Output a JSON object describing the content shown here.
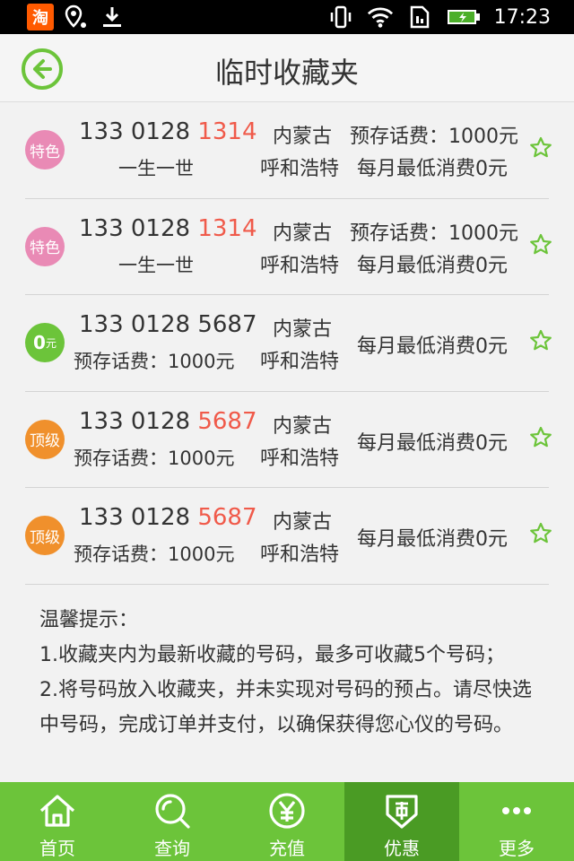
{
  "status_bar": {
    "time": "17:23",
    "taobao_label": "淘"
  },
  "header": {
    "title": "临时收藏夹"
  },
  "items": [
    {
      "badge": "特色",
      "badge_type": "special",
      "number_prefix": "133 0128 ",
      "number_suffix": "1314",
      "suffix_highlight": true,
      "sub": "一生一世",
      "region_line1": "内蒙古",
      "region_line2": "呼和浩特",
      "prestore": "预存话费：1000元",
      "min_spend": "每月最低消费0元"
    },
    {
      "badge": "特色",
      "badge_type": "special",
      "number_prefix": "133 0128 ",
      "number_suffix": "1314",
      "suffix_highlight": true,
      "sub": "一生一世",
      "region_line1": "内蒙古",
      "region_line2": "呼和浩特",
      "prestore": "预存话费：1000元",
      "min_spend": "每月最低消费0元"
    },
    {
      "badge": "0",
      "badge_unit": "元",
      "badge_type": "zero",
      "number_prefix": "133 0128 ",
      "number_suffix": "5687",
      "suffix_highlight": false,
      "sub": "预存话费：1000元",
      "region_line1": "内蒙古",
      "region_line2": "呼和浩特",
      "min_spend": "每月最低消费0元"
    },
    {
      "badge": "顶级",
      "badge_type": "top",
      "number_prefix": "133 0128 ",
      "number_suffix": "5687",
      "suffix_highlight": true,
      "sub": "预存话费：1000元",
      "region_line1": "内蒙古",
      "region_line2": "呼和浩特",
      "min_spend": "每月最低消费0元"
    },
    {
      "badge": "顶级",
      "badge_type": "top",
      "number_prefix": "133 0128 ",
      "number_suffix": "5687",
      "suffix_highlight": true,
      "sub": "预存话费：1000元",
      "region_line1": "内蒙古",
      "region_line2": "呼和浩特",
      "min_spend": "每月最低消费0元"
    }
  ],
  "tips": {
    "title": "温馨提示：",
    "line1": "1.收藏夹内为最新收藏的号码，最多可收藏5个号码；",
    "line2": "2.将号码放入收藏夹，并未实现对号码的预占。请尽快选中号码，完成订单并支付，以确保获得您心仪的号码。"
  },
  "tabbar": {
    "tabs": [
      {
        "label": "首页",
        "icon": "home-icon"
      },
      {
        "label": "查询",
        "icon": "search-icon"
      },
      {
        "label": "充值",
        "icon": "yen-icon"
      },
      {
        "label": "优惠",
        "icon": "discount-icon",
        "active": true
      },
      {
        "label": "更多",
        "icon": "more-icon"
      }
    ]
  },
  "colors": {
    "brand_green": "#6cc43a",
    "active_tab": "#4a9b24",
    "highlight_red": "#f05a4a",
    "badge_pink": "#e98ab5",
    "badge_orange": "#f0902c"
  }
}
